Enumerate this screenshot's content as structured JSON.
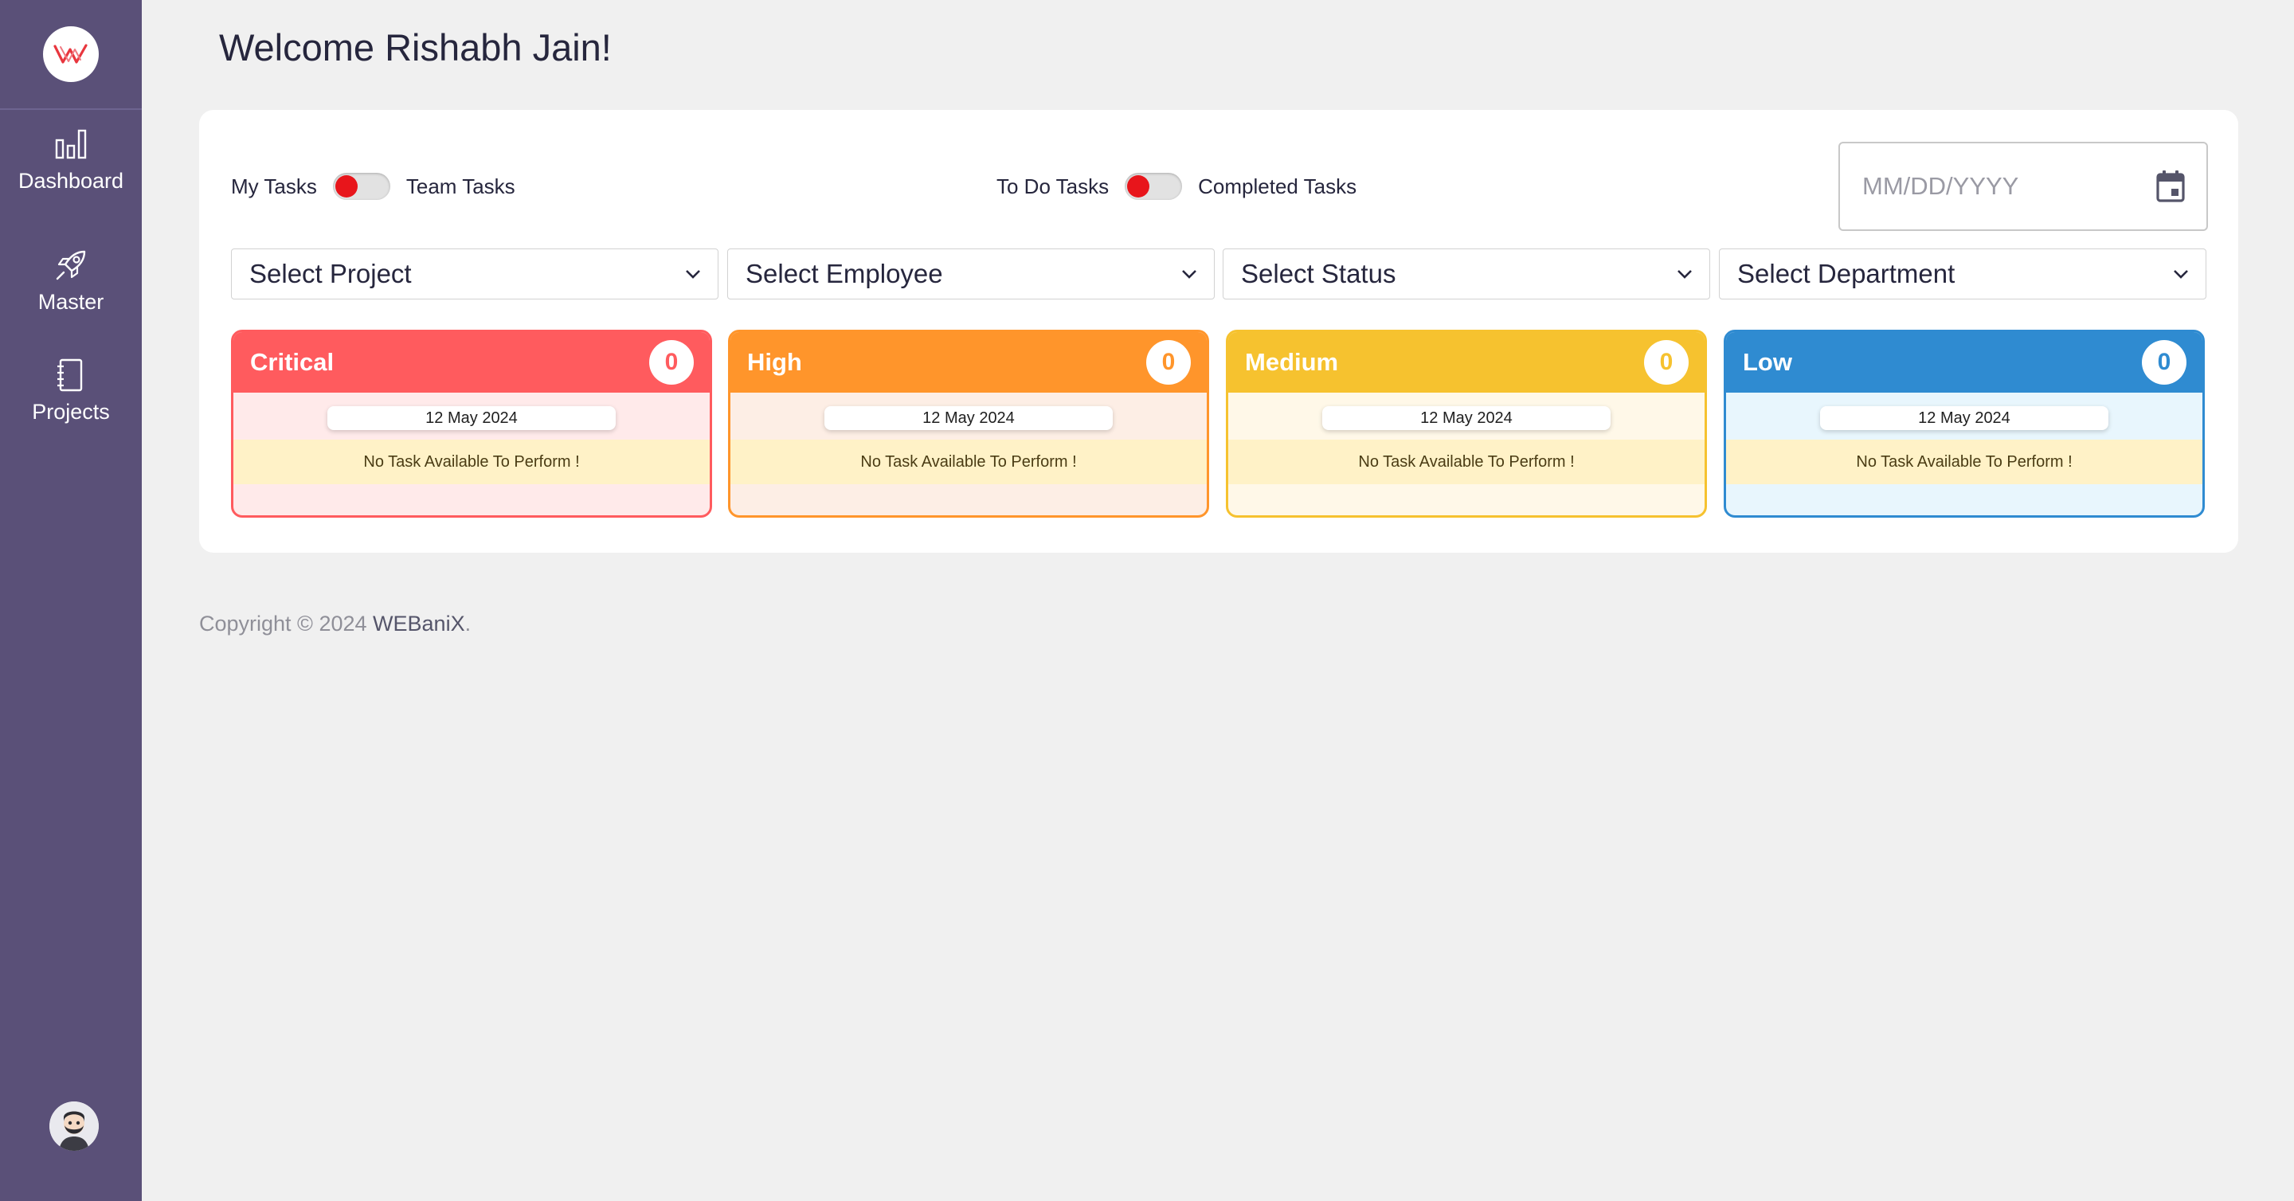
{
  "sidebar": {
    "logo_alt": "WEBaniX",
    "items": [
      {
        "label": "Dashboard",
        "icon": "bar-chart-icon"
      },
      {
        "label": "Master",
        "icon": "rocket-icon"
      },
      {
        "label": "Projects",
        "icon": "notebook-icon"
      }
    ],
    "avatar_icon": "user-avatar-icon"
  },
  "header": {
    "welcome": "Welcome Rishabh Jain!"
  },
  "filters": {
    "toggle_task_scope": {
      "left_label": "My Tasks",
      "right_label": "Team Tasks",
      "active": "left"
    },
    "toggle_task_state": {
      "left_label": "To Do Tasks",
      "right_label": "Completed Tasks",
      "active": "left"
    },
    "date_placeholder": "MM/DD/YYYY",
    "selects": [
      {
        "value": "Select Project"
      },
      {
        "value": "Select Employee"
      },
      {
        "value": "Select Status"
      },
      {
        "value": "Select Department"
      }
    ]
  },
  "cards": [
    {
      "title": "Critical",
      "count": "0",
      "date": "12 May 2024",
      "message": "No Task Available To Perform !",
      "color": "#ff5b5e",
      "tint": "#ffeaea"
    },
    {
      "title": "High",
      "count": "0",
      "date": "12 May 2024",
      "message": "No Task Available To Perform !",
      "color": "#ff952b",
      "tint": "#fdeee5"
    },
    {
      "title": "Medium",
      "count": "0",
      "date": "12 May 2024",
      "message": "No Task Available To Perform !",
      "color": "#f6c22f",
      "tint": "#fff8e8"
    },
    {
      "title": "Low",
      "count": "0",
      "date": "12 May 2024",
      "message": "No Task Available To Perform !",
      "color": "#2f8bd1",
      "tint": "#e8f6fd"
    }
  ],
  "footer": {
    "copyright": "Copyright © 2024 ",
    "brand": "WEBaniX",
    "suffix": "."
  },
  "colors": {
    "sidebar": "#5a5078",
    "toggle_knob": "#e8151b",
    "background": "#f0f0f0"
  }
}
